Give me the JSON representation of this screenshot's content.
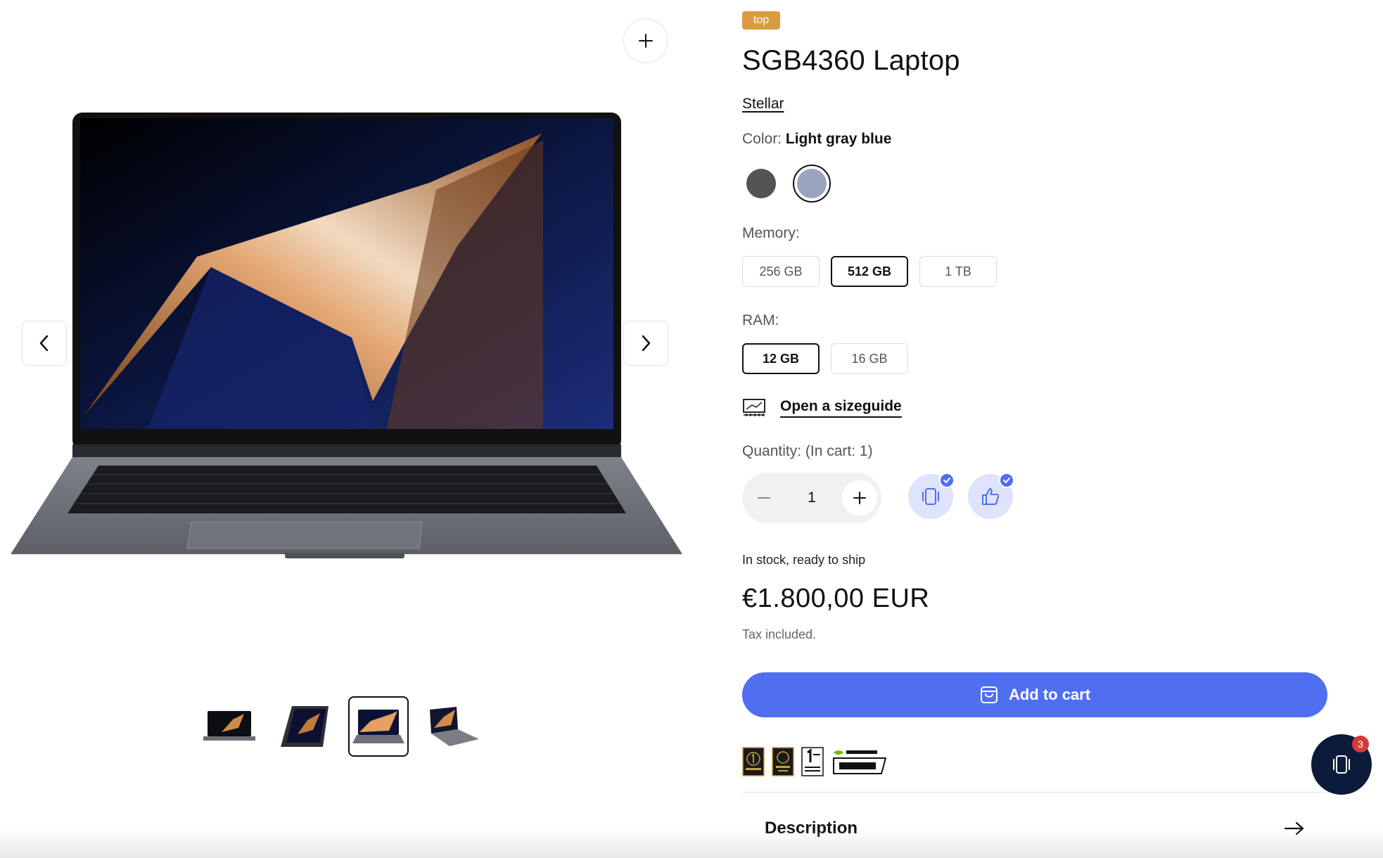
{
  "gallery": {
    "zoom_icon": "plus-icon",
    "prev_icon": "chevron-left-icon",
    "next_icon": "chevron-right-icon",
    "thumbnails": [
      {
        "view": "laptop-front"
      },
      {
        "view": "laptop-tent"
      },
      {
        "view": "laptop-front-open",
        "active": true
      },
      {
        "view": "laptop-angled"
      }
    ]
  },
  "product": {
    "badge": "top",
    "title": "SGB4360 Laptop",
    "vendor": "Stellar",
    "color": {
      "label": "Color:",
      "selected": "Light gray blue",
      "swatches": [
        {
          "hex": "#545454",
          "active": false
        },
        {
          "hex": "#9aa5bd",
          "active": true
        }
      ]
    },
    "memory": {
      "label": "Memory:",
      "options": [
        "256 GB",
        "512 GB",
        "1 TB"
      ],
      "selected": "512 GB"
    },
    "ram": {
      "label": "RAM:",
      "options": [
        "12 GB",
        "16 GB"
      ],
      "selected": "12 GB"
    },
    "sizeguide": {
      "label": "Open a sizeguide",
      "icon": "monitor-ruler-icon"
    },
    "quantity": {
      "label": "Quantity: (In cart: 1)",
      "value": "1",
      "minus_icon": "minus-icon",
      "plus_icon": "plus-icon"
    },
    "actions": [
      {
        "icon": "device-icon",
        "checked": true
      },
      {
        "icon": "thumbs-up-icon",
        "checked": true
      }
    ],
    "stock": "In stock, ready to ship",
    "price": "€1.800,00 EUR",
    "tax": "Tax included.",
    "add_to_cart": {
      "label": "Add to cart",
      "icon": "shopping-bag-icon"
    },
    "awards": [
      {
        "icon": "award-no1-icon"
      },
      {
        "icon": "award-oled-icon"
      },
      {
        "icon": "warranty-1-year-icon"
      },
      {
        "icon": "nvidia-studio-icon"
      }
    ],
    "description": {
      "label": "Description",
      "icon": "arrow-right-icon"
    }
  },
  "floating_cart": {
    "count": "3",
    "icon": "device-icon"
  },
  "colors": {
    "accent": "#4f6ef0",
    "badge": "#d99b3d",
    "dark": "#0d1b3a",
    "notification": "#d83a3a"
  }
}
